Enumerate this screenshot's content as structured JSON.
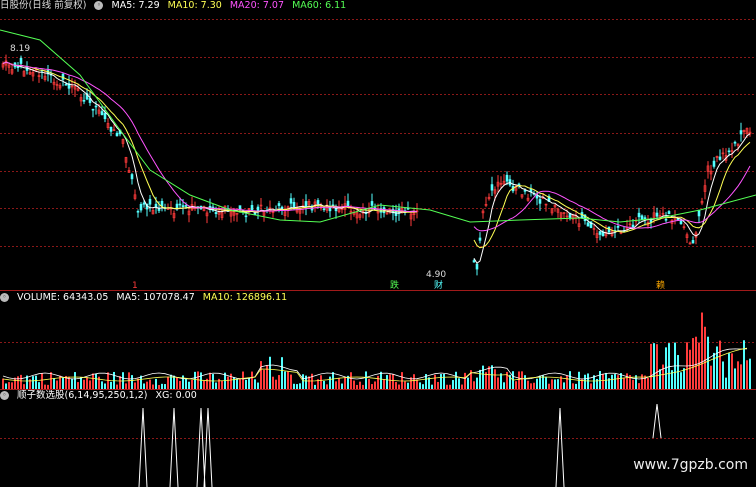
{
  "price_panel": {
    "title": "日股份(日线 前复权)",
    "ma5": "MA5: 7.29",
    "ma10": "MA10: 7.30",
    "ma20": "MA20: 7.07",
    "ma60": "MA60: 6.11",
    "high_label": "8.19",
    "low_label": "4.90"
  },
  "events": {
    "e1": "跌",
    "e2": "财",
    "e3": "赖",
    "e0": "1"
  },
  "volume_panel": {
    "title": "VOLUME: 64343.05",
    "ma5": "MA5: 107078.47",
    "ma10": "MA10: 126896.11"
  },
  "indicator_panel": {
    "title": "顺子数选股(6,14,95,250,1,2)",
    "xg": "XG: 0.00"
  },
  "watermark": "www.7gpzb.com",
  "colors": {
    "up": "#ff3b3b",
    "down": "#54ffff",
    "ma5": "#ffffff",
    "ma10": "#ffff54",
    "ma20": "#ff54ff",
    "ma60": "#54ff54",
    "grid": "#8a1818"
  }
}
